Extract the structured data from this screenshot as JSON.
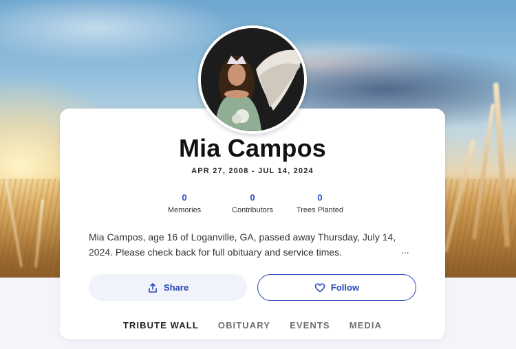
{
  "profile": {
    "name": "Mia Campos",
    "dates": "APR 27, 2008 - JUL 14, 2024"
  },
  "stats": [
    {
      "value": "0",
      "label": "Memories"
    },
    {
      "value": "0",
      "label": "Contributors"
    },
    {
      "value": "0",
      "label": "Trees Planted"
    }
  ],
  "bio": {
    "text": "Mia Campos, age 16 of Loganville, GA, passed away Thursday, July 14, 2024. Please check back for full obituary and service times.",
    "more": "..."
  },
  "actions": {
    "share_label": "Share",
    "follow_label": "Follow"
  },
  "tabs": [
    {
      "label": "TRIBUTE WALL",
      "active": true
    },
    {
      "label": "OBITUARY"
    },
    {
      "label": "EVENTS"
    },
    {
      "label": "MEDIA"
    }
  ],
  "icons": {
    "share": "share-upload-icon",
    "follow": "heart-icon"
  },
  "colors": {
    "accent": "#2846b8",
    "stat_number": "#2f4fd0",
    "text": "#111111"
  }
}
